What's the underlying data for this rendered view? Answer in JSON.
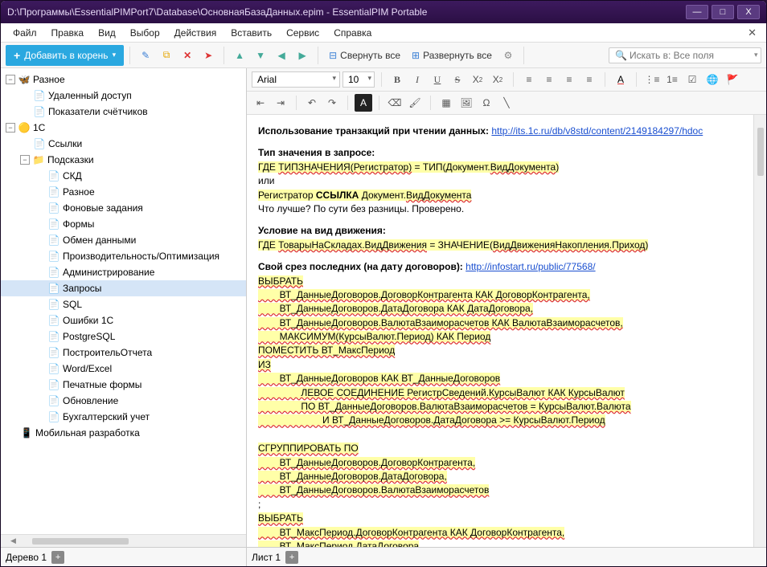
{
  "window": {
    "title": "D:\\Программы\\EssentialPIMPort7\\Database\\ОсновнаяБазаДанных.epim - EssentialPIM Portable"
  },
  "menu": [
    "Файл",
    "Правка",
    "Вид",
    "Выбор",
    "Действия",
    "Вставить",
    "Сервис",
    "Справка"
  ],
  "toolbar": {
    "add_root": "Добавить в корень",
    "collapse_all": "Свернуть все",
    "expand_all": "Развернуть все",
    "search_placeholder": "Искать в: Все поля"
  },
  "tree": {
    "root1": {
      "label": "Разное",
      "icon": "multi",
      "exp": "-"
    },
    "root1_children": [
      {
        "label": "Удаленный доступ",
        "icon": "note"
      },
      {
        "label": "Показатели счётчиков",
        "icon": "note"
      }
    ],
    "root2": {
      "label": "1С",
      "icon": "1c",
      "exp": "-"
    },
    "root2_children": [
      {
        "label": "Ссылки",
        "icon": "note",
        "exp": ""
      },
      {
        "label": "Подсказки",
        "icon": "folder",
        "exp": "-",
        "children": [
          {
            "label": "СКД"
          },
          {
            "label": "Разное"
          },
          {
            "label": "Фоновые задания"
          },
          {
            "label": "Формы"
          },
          {
            "label": "Обмен данными"
          },
          {
            "label": "Производительность/Оптимизация"
          },
          {
            "label": "Администрирование"
          },
          {
            "label": "Запросы",
            "selected": true
          },
          {
            "label": "SQL"
          },
          {
            "label": "Ошибки 1С"
          },
          {
            "label": "PostgreSQL"
          },
          {
            "label": "ПостроительОтчета"
          },
          {
            "label": "Word/Excel"
          },
          {
            "label": "Печатные формы"
          },
          {
            "label": "Обновление"
          },
          {
            "label": "Бухгалтерский учет"
          }
        ]
      }
    ],
    "root3": {
      "label": "Мобильная разработка",
      "icon": "mobile"
    }
  },
  "tree_tab": "Дерево 1",
  "editor": {
    "font": "Arial",
    "size": "10",
    "sheet": "Лист 1"
  },
  "content": {
    "h1": "Использование транзакций при чтении данных:",
    "link1": "http://its.1c.ru/db/v8std/content/2149184297/hdoc",
    "h2": "Тип значения в запросе:",
    "l2a_pre": "ГДЕ ",
    "l2a_spell": "ТИПЗНАЧЕНИЯ(Регистратор)",
    "l2a_mid": " = ТИП(Документ.",
    "l2a_spell2": "ВидДокумента",
    "l2a_end": ")",
    "l2b": "или",
    "l2c_pre": "Регистратор ",
    "l2c_b": "ССЫЛКА",
    "l2c_mid": " Документ.",
    "l2c_spell": "ВидДокумента",
    "l2d": "Что лучше? По сути без разницы. Проверено.",
    "h3": "Условие на вид движения:",
    "l3a_pre": "ГДЕ ",
    "l3a_s1": "ТоварыНаСкладах.ВидДвижения",
    "l3a_mid": " = ЗНАЧЕНИЕ(",
    "l3a_s2": "ВидДвиженияНакопления.Приход",
    "l3a_end": ")",
    "h4": "Свой срез последних (на дату договоров):",
    "link2": "http://infostart.ru/public/77568/",
    "q": [
      "ВЫБРАТЬ",
      "        ВТ_ДанныеДоговоров.ДоговорКонтрагента КАК ДоговорКонтрагента,",
      "        ВТ_ДанныеДоговоров.ДатаДоговора КАК ДатаДоговора,",
      "        ВТ_ДанныеДоговоров.ВалютаВзаиморасчетов КАК ВалютаВзаиморасчетов,",
      "        МАКСИМУМ(КурсыВалют.Период) КАК Период",
      "ПОМЕСТИТЬ ВТ_МаксПериод",
      "ИЗ",
      "        ВТ_ДанныеДоговоров КАК ВТ_ДанныеДоговоров",
      "                ЛЕВОЕ СОЕДИНЕНИЕ РегистрСведений.КурсыВалют КАК КурсыВалют",
      "                ПО ВТ_ДанныеДоговоров.ВалютаВзаиморасчетов = КурсыВалют.Валюта",
      "                        И ВТ_ДанныеДоговоров.ДатаДоговора >= КурсыВалют.Период",
      "",
      "СГРУППИРОВАТЬ ПО",
      "        ВТ_ДанныеДоговоров.ДоговорКонтрагента,",
      "        ВТ_ДанныеДоговоров.ДатаДоговора,",
      "        ВТ_ДанныеДоговоров.ВалютаВзаиморасчетов",
      ";",
      "ВЫБРАТЬ",
      "        ВТ_МаксПериод.ДоговорКонтрагента КАК ДоговорКонтрагента,",
      "        ВТ_МаксПериод.ДатаДоговора"
    ]
  }
}
